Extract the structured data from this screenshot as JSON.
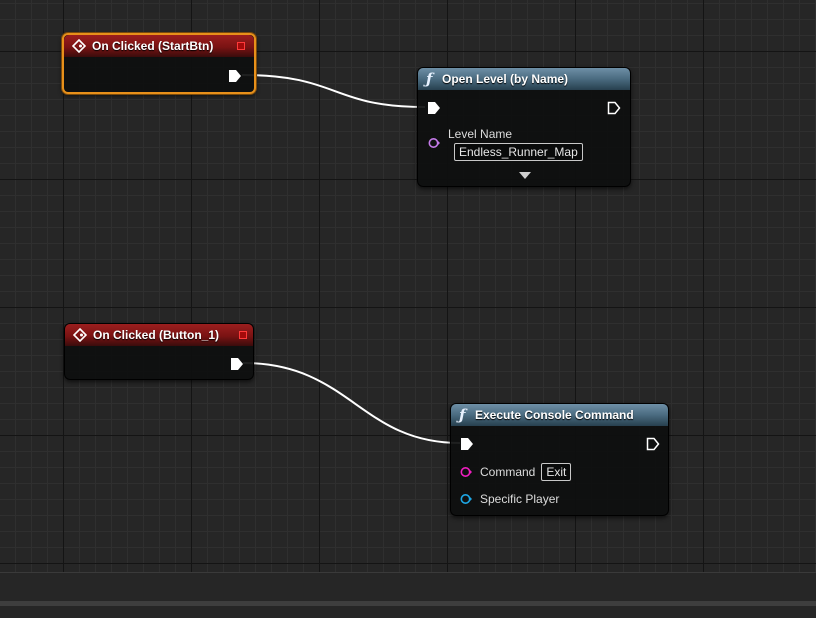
{
  "graph": {
    "nodes": {
      "on_clicked_start": {
        "title": "On Clicked (StartBtn)",
        "selected": true
      },
      "open_level": {
        "title": "Open Level (by Name)",
        "level_name_label": "Level Name",
        "level_name_value": "Endless_Runner_Map"
      },
      "on_clicked_button1": {
        "title": "On Clicked (Button_1)"
      },
      "execute_console_command": {
        "title": "Execute Console Command",
        "command_label": "Command",
        "command_value": "Exit",
        "specific_player_label": "Specific Player"
      }
    }
  },
  "icons": {
    "event": "event-diamond-icon",
    "function": "function-icon",
    "exec": "exec-pin-icon",
    "delegate": "delegate-pin-icon",
    "expand": "expand-arrow-icon"
  },
  "colors": {
    "event_header": "#9b1e1e",
    "function_header": "#4a6b80",
    "selection": "#e8901a",
    "name_pin": "#c47ae8",
    "string_pin": "#f01ec0",
    "object_pin": "#1ea8e6",
    "wire": "#ffffff"
  }
}
